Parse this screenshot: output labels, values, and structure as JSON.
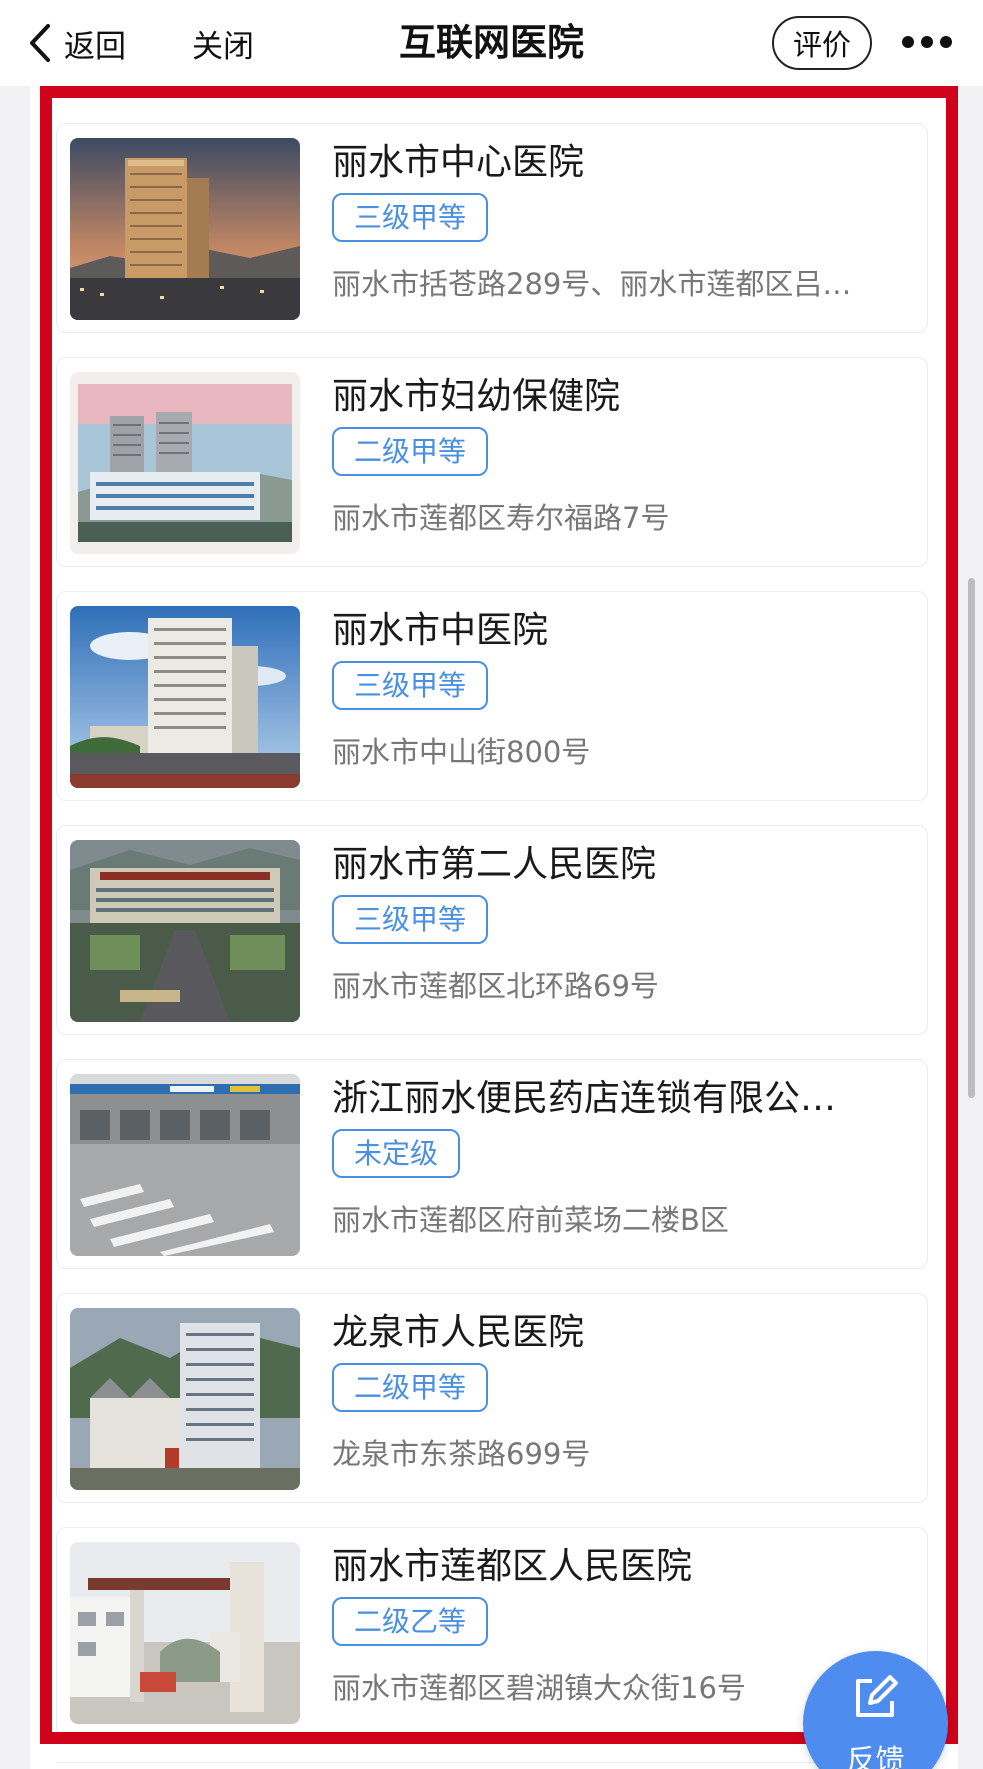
{
  "nav": {
    "back_label": "返回",
    "close_label": "关闭",
    "title": "互联网医院",
    "rate_label": "评价",
    "more_icon": "more-dots-icon"
  },
  "hospitals": [
    {
      "name": "丽水市中心医院",
      "level": "三级甲等",
      "address": "丽水市括苍路289号、丽水市莲都区吕…",
      "photo": "tall-hospital-tower-at-dusk"
    },
    {
      "name": "丽水市妇幼保健院",
      "level": "二级甲等",
      "address": "丽水市莲都区寿尔福路7号",
      "photo": "twin-towers-with-low-building"
    },
    {
      "name": "丽水市中医院",
      "level": "三级甲等",
      "address": "丽水市中山街800号",
      "photo": "white-highrise-blue-sky"
    },
    {
      "name": "丽水市第二人民医院",
      "level": "三级甲等",
      "address": "丽水市莲都区北环路69号",
      "photo": "campus-entrance-aerial"
    },
    {
      "name": "浙江丽水便民药店连锁有限公…",
      "level": "未定级",
      "address": "丽水市莲都区府前菜场二楼B区",
      "photo": "street-storefront-crosswalk"
    },
    {
      "name": "龙泉市人民医院",
      "level": "二级甲等",
      "address": "龙泉市东茶路699号",
      "photo": "hospital-buildings-hillside"
    },
    {
      "name": "丽水市莲都区人民医院",
      "level": "二级乙等",
      "address": "丽水市莲都区碧湖镇大众街16号",
      "photo": "gateway-arch-entrance"
    }
  ],
  "feedback": {
    "label": "反馈",
    "icon": "edit-icon"
  },
  "colors": {
    "accent": "#4a90e2",
    "highlight": "#d0021b",
    "fab": "#4f8cf0"
  }
}
